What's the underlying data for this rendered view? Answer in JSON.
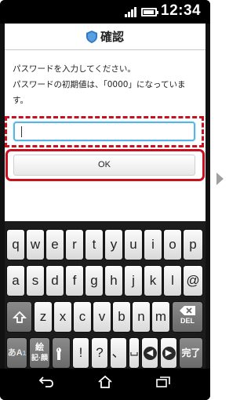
{
  "status_bar": {
    "time": "12:34",
    "signal_icon": "signal-icon",
    "battery_icon": "battery-icon"
  },
  "dialog": {
    "title": "確認",
    "title_icon": "shield-icon",
    "message_line1": "パスワードを入力してください。",
    "message_line2": "パスワードの初期値は、「0000」になっています。",
    "input_value": "",
    "ok_label": "OK"
  },
  "keyboard": {
    "row1": [
      "q",
      "w",
      "e",
      "r",
      "t",
      "y",
      "u",
      "i",
      "o",
      "p"
    ],
    "row2": [
      "a",
      "s",
      "d",
      "f",
      "g",
      "h",
      "j",
      "k",
      "l",
      "@"
    ],
    "row3": [
      "z",
      "x",
      "c",
      "v",
      "b",
      "n",
      "m"
    ],
    "shift_icon": "shift-icon",
    "delete_label": "DEL",
    "mode_label": "あA",
    "mode_sub": "1",
    "emoji_label_top": "絵",
    "emoji_label_bottom": "記·顔",
    "tools_icon": "wrench-icon",
    "punct": [
      "!",
      "?",
      "、"
    ],
    "space_icon": "space-icon",
    "left_arrow_icon": "left-arrow-icon",
    "right_arrow_icon": "right-arrow-icon",
    "done_label": "完了"
  },
  "nav_bar": {
    "back_icon": "back-icon",
    "home_icon": "home-icon",
    "recent_icon": "recent-apps-icon"
  },
  "colors": {
    "highlight_red": "#c8101e",
    "input_focus_blue": "#5ab4e4",
    "keyboard_bg": "#1c1c1c"
  }
}
